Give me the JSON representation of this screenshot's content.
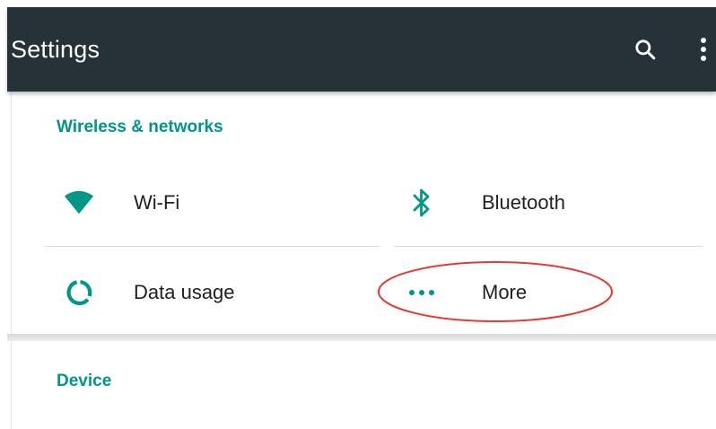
{
  "appbar": {
    "title": "Settings",
    "background": "#263238",
    "search_icon": "search-icon",
    "overflow_icon": "more-vert-icon"
  },
  "sections": [
    {
      "title": "Wireless & networks",
      "items": [
        {
          "label": "Wi-Fi",
          "icon": "wifi-icon"
        },
        {
          "label": "Bluetooth",
          "icon": "bluetooth-icon"
        },
        {
          "label": "Data usage",
          "icon": "data-usage-icon"
        },
        {
          "label": "More",
          "icon": "more-horiz-icon",
          "annotated": true
        }
      ]
    },
    {
      "title": "Device",
      "items": []
    }
  ],
  "colors": {
    "accent": "#009688",
    "annotation": "#e53935",
    "text": "#212121"
  }
}
